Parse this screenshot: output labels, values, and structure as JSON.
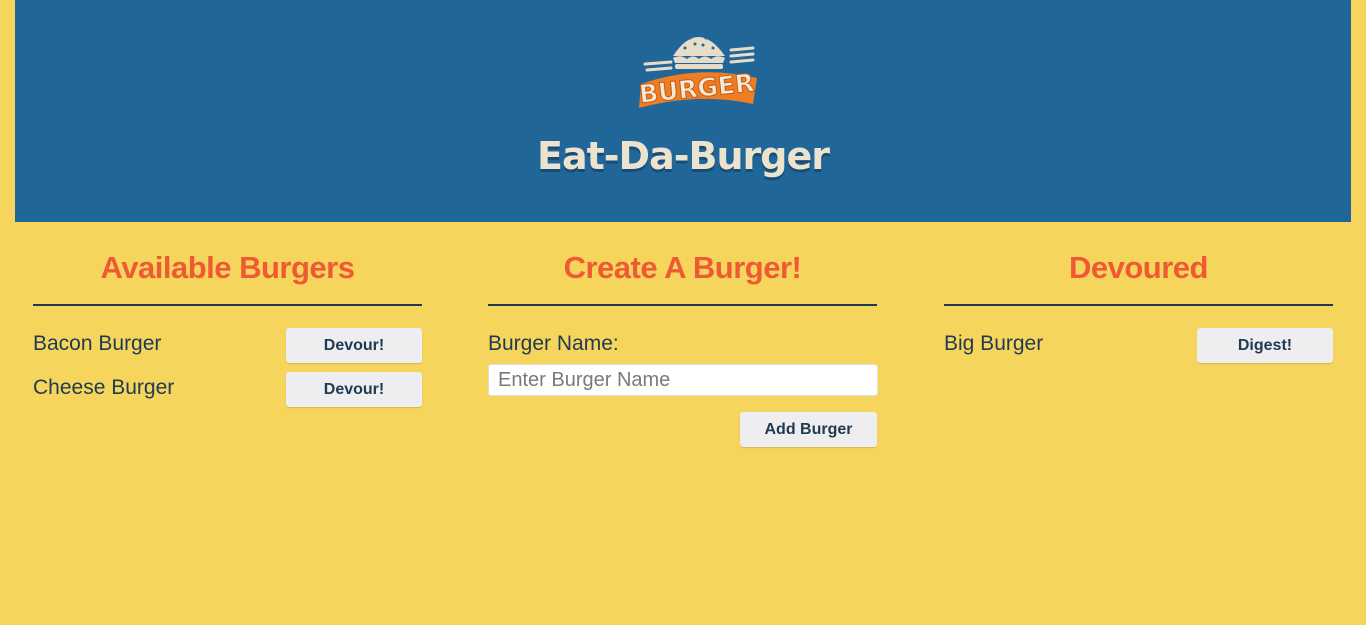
{
  "header": {
    "logo_text": "BURGER",
    "title": "Eat-Da-Burger"
  },
  "available": {
    "title": "Available Burgers",
    "items": [
      {
        "name": "Bacon Burger",
        "button": "Devour!"
      },
      {
        "name": "Cheese Burger",
        "button": "Devour!"
      }
    ]
  },
  "create": {
    "title": "Create A Burger!",
    "label": "Burger Name:",
    "input_value": "",
    "placeholder": "Enter Burger Name",
    "button": "Add Burger"
  },
  "devoured": {
    "title": "Devoured",
    "items": [
      {
        "name": "Big Burger",
        "button": "Digest!"
      }
    ]
  },
  "colors": {
    "background": "#f6d55c",
    "header": "#216699",
    "heading": "#ef5a35",
    "text": "#1f3a52",
    "button": "#eeeef0",
    "logo_text": "#ece3cf"
  }
}
